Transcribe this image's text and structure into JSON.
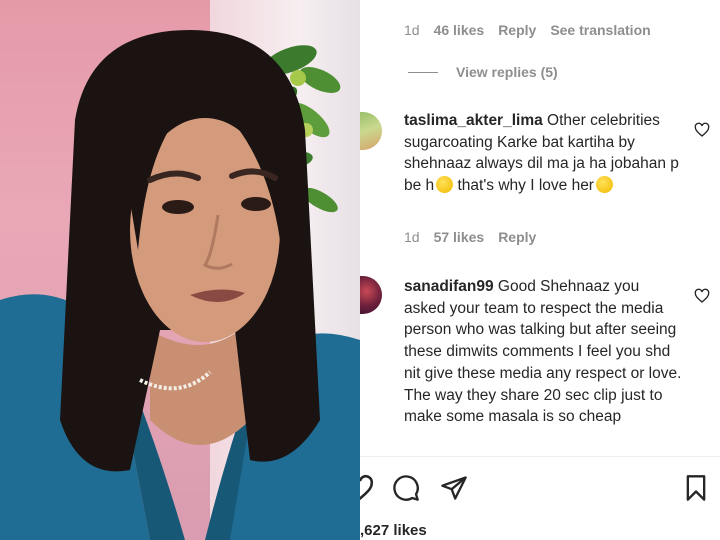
{
  "post": {
    "likes_count": "627 likes",
    "likes_prefix": ",627 likes"
  },
  "comments": [
    {
      "meta": {
        "age": "1d",
        "likes": "46 likes",
        "reply": "Reply",
        "translate": "See translation"
      },
      "view_replies": "View replies (5)"
    },
    {
      "username": "taslima_akter_lima",
      "text_1": " Other celebrities sugarcoating Karke bat kartiha by shehnaaz always dil ma ja ha jobahan p be h",
      "text_2": " that's why I love her",
      "emoji_1": "slightly-smiling-face",
      "emoji_2": "heart-eyes-face",
      "meta": {
        "age": "1d",
        "likes": "57 likes",
        "reply": "Reply"
      }
    },
    {
      "username": "sanadifan99",
      "text": " Good Shehnaaz you asked your team to respect the media person who was talking but after seeing these dimwits comments I feel you shd nit give these media any respect or love. The way they share 20 sec clip just to make some masala is so cheap"
    }
  ],
  "actions": {
    "like": "heart-icon",
    "comment": "comment-icon",
    "share": "send-icon",
    "save": "bookmark-icon"
  },
  "colors": {
    "text": "#262626",
    "muted": "#8e8e8e",
    "background": "#ffffff"
  }
}
